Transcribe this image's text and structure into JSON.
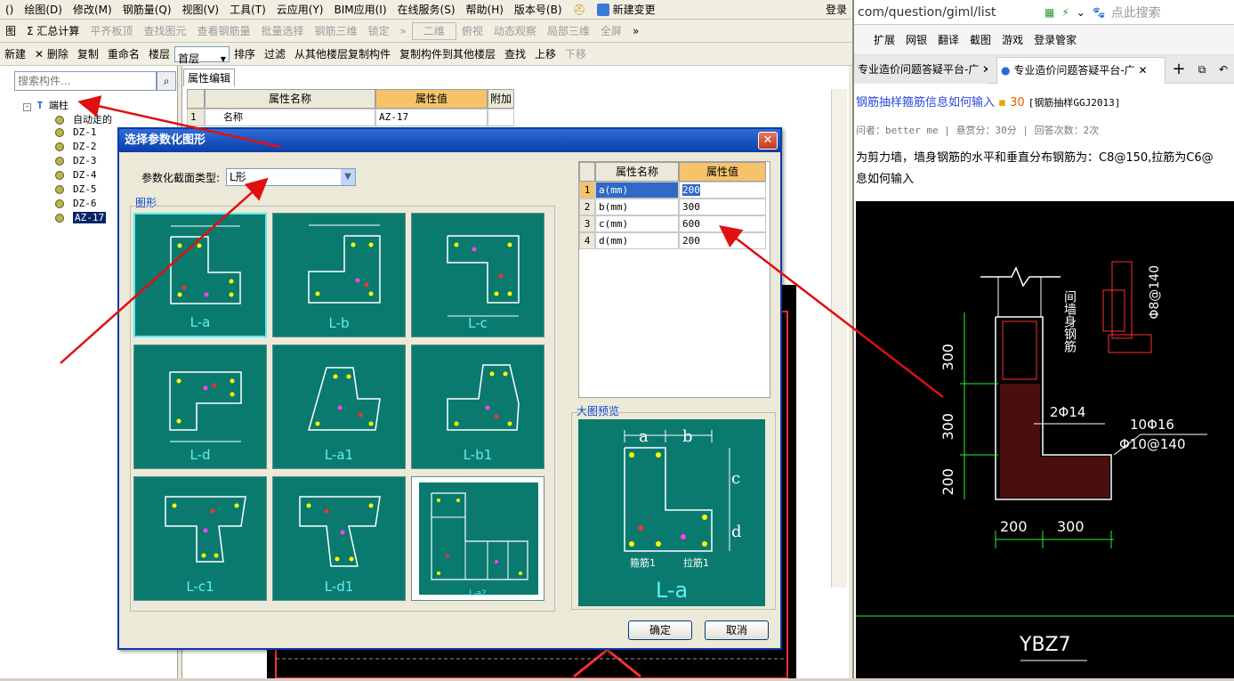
{
  "menubar": {
    "items": [
      "()",
      "绘图(D)",
      "修改(M)",
      "钢筋量(Q)",
      "视图(V)",
      "工具(T)",
      "云应用(Y)",
      "BIM应用(I)",
      "在线服务(S)",
      "帮助(H)",
      "版本号(B)",
      "新建变更",
      "登录"
    ]
  },
  "toolbar1": {
    "items": [
      "图",
      "Σ 汇总计算",
      "平齐板顶",
      "查找图元",
      "查看钢筋量",
      "批量选择",
      "钢筋三维",
      "锁定",
      "二维",
      "俯视",
      "动态观察",
      "局部三维",
      "全屏"
    ]
  },
  "toolbar2": {
    "items": [
      "新建",
      "删除",
      "复制",
      "重命名",
      "楼层",
      "首层",
      "排序",
      "过滤",
      "从其他楼层复制构件",
      "复制构件到其他楼层",
      "查找",
      "上移",
      "下移"
    ]
  },
  "left": {
    "search_placeholder": "搜索构件...",
    "tree_root": "端柱",
    "tree_items": [
      "自动走的",
      "DZ-1",
      "DZ-2",
      "DZ-3",
      "DZ-4",
      "DZ-5",
      "DZ-6",
      "AZ-17"
    ]
  },
  "props": {
    "tab": "属性编辑",
    "headers": [
      "属性名称",
      "属性值",
      "附加"
    ],
    "row": [
      "1",
      "名称",
      "AZ-17"
    ]
  },
  "dialog": {
    "title": "选择参数化图形",
    "section_type_label": "参数化截面类型:",
    "section_type_value": "L形",
    "group_label": "图形",
    "tiles": [
      "L-a",
      "L-b",
      "L-c",
      "L-d",
      "L-a1",
      "L-b1",
      "L-c1",
      "L-d1",
      "L-a2"
    ],
    "param_headers": [
      "属性名称",
      "属性值"
    ],
    "params": [
      {
        "idx": "1",
        "name": "a(mm)",
        "value": "200"
      },
      {
        "idx": "2",
        "name": "b(mm)",
        "value": "300"
      },
      {
        "idx": "3",
        "name": "c(mm)",
        "value": "600"
      },
      {
        "idx": "4",
        "name": "d(mm)",
        "value": "200"
      }
    ],
    "preview_label": "大图预览",
    "preview_name": "L-a",
    "ok": "确定",
    "cancel": "取消"
  },
  "browser": {
    "url": "com/question/giml/list",
    "search_placeholder": "点此搜索",
    "toolbar": [
      "扩展",
      "网银",
      "翻译",
      "截图",
      "游戏",
      "登录管家"
    ],
    "tabs": [
      "专业造价问题答疑平台-广",
      "专业造价问题答疑平台-广"
    ],
    "q_title": "钢筋抽样箍筋信息如何输入",
    "q_score": "30",
    "q_tag": "[钢筋抽样GGJ2013]",
    "q_meta": "问者：better me  |  悬赏分：30分  |  回答次数：2次",
    "q_body_1": "为剪力墙，墙身钢筋的水平和垂直分布钢筋为：C8@150,拉筋为C6@",
    "q_body_2": "息如何输入",
    "cad_labels": [
      "间墙身钢筋",
      "Φ8@140",
      "2Φ14",
      "10Φ16",
      "Φ10@140",
      "300",
      "300",
      "200",
      "200",
      "300",
      "YBZ7"
    ]
  },
  "colors": {
    "title_blue": "#0a3ea8",
    "tile_teal": "#0a7a6f",
    "tile_text": "#5ff0f0",
    "arrow_red": "#e01010",
    "header_orange": "#f6c36b"
  }
}
